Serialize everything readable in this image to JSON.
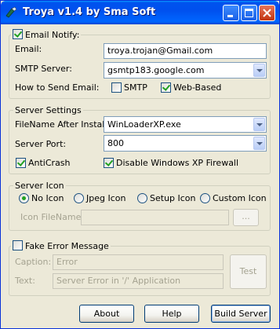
{
  "window": {
    "title": "Troya v1.4 by Sma Soft",
    "app_icon": "app-icon",
    "buttons": [
      "minimize-icon",
      "maximize-icon",
      "close-icon"
    ]
  },
  "email": {
    "notify_label": "Email Notify:",
    "notify_checked": true,
    "email_label": "Email:",
    "email_value": "troya.trojan@Gmail.com",
    "smtp_label": "SMTP Server:",
    "smtp_value": "gsmtp183.google.com",
    "how_label": "How to Send Email:",
    "smtp_option": "SMTP",
    "smtp_checked": false,
    "web_option": "Web-Based",
    "web_checked": true
  },
  "server": {
    "legend": "Server Settings",
    "filename_label": "FileName After Install:",
    "filename_value": "WinLoaderXP.exe",
    "port_label": "Server Port:",
    "port_value": "800",
    "anticrash_label": "AntiCrash",
    "anticrash_checked": true,
    "firewall_label": "Disable Windows XP Firewall",
    "firewall_checked": true
  },
  "icon": {
    "legend": "Server Icon",
    "options": [
      "No Icon",
      "Jpeg Icon",
      "Setup Icon",
      "Custom Icon"
    ],
    "selected": "No Icon",
    "filename_label": "Icon FileName:",
    "filename_value": "",
    "browse_label": "..."
  },
  "error": {
    "legend": "Fake Error Message",
    "checked": false,
    "caption_label": "Caption:",
    "caption_value": "Error",
    "text_label": "Text:",
    "text_value": "Server Error in '/' Application",
    "test_label": "Test"
  },
  "footer": {
    "about": "About",
    "help": "Help",
    "build": "Build Server"
  },
  "colors": {
    "title_bar": "#0054e3",
    "window_bg": "#ece9d8",
    "check_mark": "#21a121",
    "disabled_text": "#a5a391"
  }
}
